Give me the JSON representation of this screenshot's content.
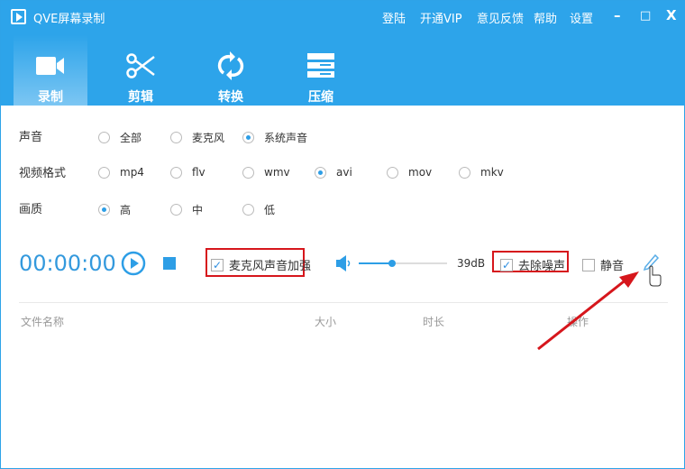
{
  "app": {
    "title": "QVE屏幕录制"
  },
  "topmenu": [
    "登陆",
    "开通VIP",
    "意见反馈",
    "帮助",
    "设置"
  ],
  "window_controls": {
    "minimize": "–",
    "maximize": "□",
    "close": "X"
  },
  "tabs": [
    {
      "label": "录制",
      "icon": "video-camera-icon",
      "active": true
    },
    {
      "label": "剪辑",
      "icon": "scissors-icon"
    },
    {
      "label": "转换",
      "icon": "refresh-icon"
    },
    {
      "label": "压缩",
      "icon": "server-icon"
    }
  ],
  "audio": {
    "label": "声音",
    "options": [
      "全部",
      "麦克风",
      "系统声音"
    ],
    "selected": "系统声音"
  },
  "format": {
    "label": "视频格式",
    "options": [
      "mp4",
      "flv",
      "wmv",
      "avi",
      "mov",
      "mkv"
    ],
    "selected": "avi"
  },
  "quality": {
    "label": "画质",
    "options": [
      "高",
      "中",
      "低"
    ],
    "selected": "高"
  },
  "controls": {
    "timer": "00:00:00",
    "mic_boost": "麦克风声音加强",
    "mic_boost_checked": true,
    "volume_db": "39dB",
    "volume_fraction": 0.38,
    "denoise": "去除噪声",
    "denoise_checked": true,
    "mute": "静音",
    "mute_checked": false
  },
  "table": {
    "headers": [
      "文件名称",
      "大小",
      "时长",
      "操作"
    ]
  },
  "colors": {
    "accent": "#2da4ea",
    "highlight": "#d6161c"
  }
}
